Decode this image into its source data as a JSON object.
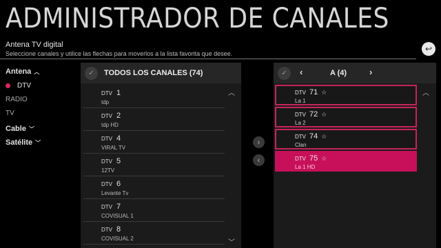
{
  "header": {
    "title": "ADMINISTRADOR DE CANALES",
    "subtitle": "Antena TV digital",
    "instructions": "Seleccione canales y utilice las flechas para moverlos a la lista favorita que desee."
  },
  "sidebar": {
    "groups": [
      {
        "label": "Antena",
        "expanded": true
      },
      {
        "label": "Cable",
        "expanded": false
      },
      {
        "label": "Satélite",
        "expanded": false
      }
    ],
    "antena_items": [
      "DTV",
      "RADIO",
      "TV"
    ],
    "active_item": "DTV"
  },
  "all_channels": {
    "title": "TODOS LOS CANALES (74)",
    "rows": [
      {
        "type": "DTV",
        "number": "1",
        "name": "tdp"
      },
      {
        "type": "DTV",
        "number": "2",
        "name": "tdp HD"
      },
      {
        "type": "DTV",
        "number": "4",
        "name": "VIRAL TV"
      },
      {
        "type": "DTV",
        "number": "5",
        "name": "12TV"
      },
      {
        "type": "DTV",
        "number": "6",
        "name": "Levante Tv"
      },
      {
        "type": "DTV",
        "number": "7",
        "name": "COVISUAL 1"
      },
      {
        "type": "DTV",
        "number": "8",
        "name": "COVISUAL 2"
      }
    ]
  },
  "favorites": {
    "title": "A (4)",
    "rows": [
      {
        "type": "DTV",
        "number": "71",
        "name": "La 1",
        "selected": false
      },
      {
        "type": "DTV",
        "number": "72",
        "name": "La 2",
        "selected": false
      },
      {
        "type": "DTV",
        "number": "74",
        "name": "Clan",
        "selected": false
      },
      {
        "type": "DTV",
        "number": "75",
        "name": "La 1 HD",
        "selected": true
      }
    ]
  },
  "icons": {
    "back": "back-arrow-icon",
    "check": "check-icon",
    "move_right": "chevron-right-icon",
    "move_left": "chevron-left-icon",
    "favorite": "star-icon"
  },
  "colors": {
    "accent": "#c8105a",
    "background": "#000000",
    "panel": "#1b1b1b"
  }
}
